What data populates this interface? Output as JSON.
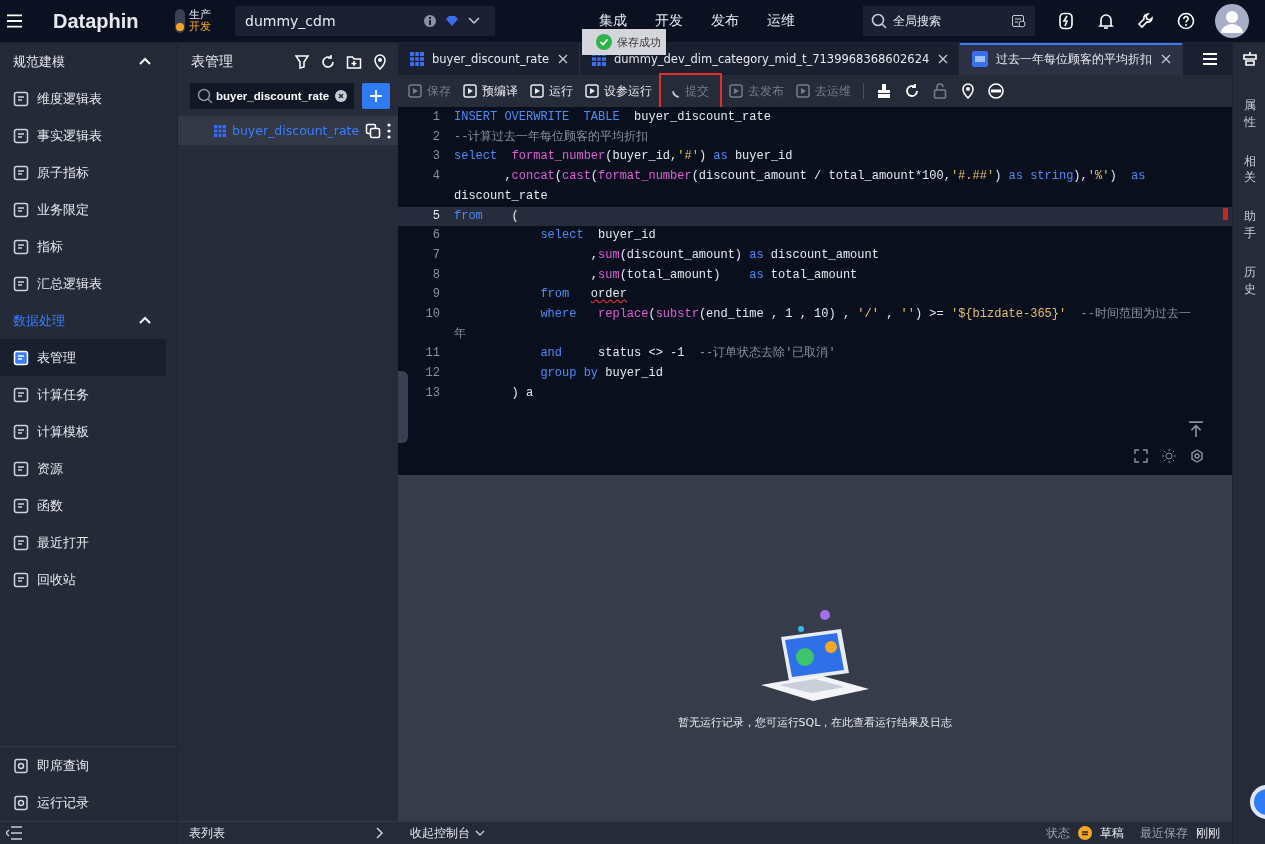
{
  "topbar": {
    "logo": "Dataphin",
    "env": [
      {
        "label": "生产",
        "selected": false
      },
      {
        "label": "开发",
        "selected": true
      }
    ],
    "project": "dummy_cdm",
    "nav": [
      {
        "label": "集成",
        "selected": false
      },
      {
        "label": "开发",
        "selected": false
      },
      {
        "label": "发布",
        "selected": false
      },
      {
        "label": "运维",
        "selected": false
      }
    ],
    "search": {
      "placeholder": "全局搜索"
    }
  },
  "toast": {
    "text": "保存成功"
  },
  "sidebar": {
    "groups": [
      {
        "title": "规范建模",
        "expanded": true,
        "items": [
          {
            "label": "维度逻辑表",
            "selected": false
          },
          {
            "label": "事实逻辑表",
            "selected": false
          },
          {
            "label": "原子指标",
            "selected": false
          },
          {
            "label": "业务限定",
            "selected": false
          },
          {
            "label": "指标",
            "selected": false
          },
          {
            "label": "汇总逻辑表",
            "selected": false
          }
        ]
      },
      {
        "title": "数据处理",
        "expanded": true,
        "items": [
          {
            "label": "表管理",
            "selected": true
          },
          {
            "label": "计算任务",
            "selected": false
          },
          {
            "label": "计算模板",
            "selected": false
          },
          {
            "label": "资源",
            "selected": false
          },
          {
            "label": "函数",
            "selected": false
          },
          {
            "label": "最近打开",
            "selected": false
          },
          {
            "label": "回收站",
            "selected": false
          }
        ]
      }
    ],
    "bottom_items": [
      {
        "label": "即席查询"
      },
      {
        "label": "运行记录"
      }
    ]
  },
  "panel": {
    "title": "表管理",
    "search": {
      "value": "buyer_discount_rate"
    },
    "tree": [
      {
        "label": "buyer_discount_rate",
        "selected": true
      }
    ],
    "footer": "表列表"
  },
  "tabs": [
    {
      "label": "buyer_discount_rate",
      "selected": false
    },
    {
      "label": "dummy_dev_dim_category_mid_t_7139968368602624",
      "selected": false
    },
    {
      "label": "过去一年每位顾客的平均折扣",
      "selected": true
    }
  ],
  "toolbar": [
    {
      "label": "保存",
      "disabled": true,
      "loading": false,
      "highlighted": false
    },
    {
      "label": "预编译",
      "disabled": false,
      "loading": false,
      "highlighted": false
    },
    {
      "label": "运行",
      "disabled": false,
      "loading": false,
      "highlighted": false
    },
    {
      "label": "设参运行",
      "disabled": false,
      "loading": false,
      "highlighted": false
    },
    {
      "label": "提交",
      "disabled": true,
      "loading": true,
      "highlighted": true
    },
    {
      "label": "去发布",
      "disabled": true,
      "loading": false,
      "highlighted": false
    },
    {
      "label": "去运维",
      "disabled": true,
      "loading": false,
      "highlighted": false
    }
  ],
  "code": {
    "lines": [
      {
        "number": "1",
        "rows": [
          [
            {
              "kind": "kw",
              "text": "INSERT OVERWRITE  TABLE"
            },
            {
              "kind": "id",
              "text": "  buyer_discount_rate"
            }
          ]
        ]
      },
      {
        "number": "2",
        "rows": [
          [
            {
              "kind": "cm",
              "text": "--计算过去一年每位顾客的平均折扣"
            }
          ]
        ]
      },
      {
        "number": "3",
        "rows": [
          [
            {
              "kind": "kw",
              "text": "select"
            },
            {
              "kind": "id",
              "text": "  "
            },
            {
              "kind": "fn",
              "text": "format_number"
            },
            {
              "kind": "id",
              "text": "(buyer_id,"
            },
            {
              "kind": "str",
              "text": "'#'"
            },
            {
              "kind": "id",
              "text": ") "
            },
            {
              "kind": "kw",
              "text": "as"
            },
            {
              "kind": "id",
              "text": " buyer_id"
            }
          ]
        ]
      },
      {
        "number": "4",
        "rows": [
          [
            {
              "kind": "id",
              "text": "       ,"
            },
            {
              "kind": "fn",
              "text": "concat"
            },
            {
              "kind": "id",
              "text": "("
            },
            {
              "kind": "fn",
              "text": "cast"
            },
            {
              "kind": "id",
              "text": "("
            },
            {
              "kind": "fn",
              "text": "format_number"
            },
            {
              "kind": "id",
              "text": "(discount_amount / total_amount*100,"
            },
            {
              "kind": "str",
              "text": "'#.##'"
            },
            {
              "kind": "id",
              "text": ") "
            },
            {
              "kind": "kw",
              "text": "as string"
            },
            {
              "kind": "id",
              "text": "),"
            },
            {
              "kind": "str",
              "text": "'%'"
            },
            {
              "kind": "id",
              "text": ")  "
            },
            {
              "kind": "kw",
              "text": "as"
            }
          ],
          [
            {
              "kind": "id",
              "text": "discount_rate"
            }
          ]
        ]
      },
      {
        "number": "5",
        "current": true,
        "rows": [
          [
            {
              "kind": "kw",
              "text": "from"
            },
            {
              "kind": "id",
              "text": "    ("
            }
          ]
        ]
      },
      {
        "number": "6",
        "rows": [
          [
            {
              "kind": "id",
              "text": "            "
            },
            {
              "kind": "kw",
              "text": "select"
            },
            {
              "kind": "id",
              "text": "  buyer_id"
            }
          ]
        ]
      },
      {
        "number": "7",
        "rows": [
          [
            {
              "kind": "id",
              "text": "                   ,"
            },
            {
              "kind": "fn",
              "text": "sum"
            },
            {
              "kind": "id",
              "text": "(discount_amount) "
            },
            {
              "kind": "kw",
              "text": "as"
            },
            {
              "kind": "id",
              "text": " discount_amount"
            }
          ]
        ]
      },
      {
        "number": "8",
        "rows": [
          [
            {
              "kind": "id",
              "text": "                   ,"
            },
            {
              "kind": "fn",
              "text": "sum"
            },
            {
              "kind": "id",
              "text": "(total_amount)    "
            },
            {
              "kind": "kw",
              "text": "as"
            },
            {
              "kind": "id",
              "text": " total_amount"
            }
          ]
        ]
      },
      {
        "number": "9",
        "rows": [
          [
            {
              "kind": "id",
              "text": "            "
            },
            {
              "kind": "kw",
              "text": "from"
            },
            {
              "kind": "id",
              "text": "   "
            },
            {
              "kind": "err",
              "text": "order"
            }
          ]
        ]
      },
      {
        "number": "10",
        "rows": [
          [
            {
              "kind": "id",
              "text": "            "
            },
            {
              "kind": "kw",
              "text": "where"
            },
            {
              "kind": "id",
              "text": "   "
            },
            {
              "kind": "fn",
              "text": "replace"
            },
            {
              "kind": "id",
              "text": "("
            },
            {
              "kind": "fn",
              "text": "substr"
            },
            {
              "kind": "id",
              "text": "(end_time , 1 , 10) , "
            },
            {
              "kind": "str",
              "text": "'/'"
            },
            {
              "kind": "id",
              "text": " , "
            },
            {
              "kind": "str",
              "text": "''"
            },
            {
              "kind": "id",
              "text": ") >= "
            },
            {
              "kind": "str",
              "text": "'${bizdate-365}'"
            },
            {
              "kind": "cm",
              "text": "  --时间范围为过去一"
            }
          ],
          [
            {
              "kind": "cm",
              "text": "年"
            }
          ]
        ]
      },
      {
        "number": "11",
        "rows": [
          [
            {
              "kind": "id",
              "text": "            "
            },
            {
              "kind": "kw",
              "text": "and"
            },
            {
              "kind": "id",
              "text": "     status <> -1  "
            },
            {
              "kind": "cm",
              "text": "--订单状态去除'已取消'"
            }
          ]
        ]
      },
      {
        "number": "12",
        "rows": [
          [
            {
              "kind": "id",
              "text": "            "
            },
            {
              "kind": "kw",
              "text": "group by"
            },
            {
              "kind": "id",
              "text": " buyer_id"
            }
          ]
        ]
      },
      {
        "number": "13",
        "rows": [
          [
            {
              "kind": "id",
              "text": "        ) a"
            }
          ]
        ]
      }
    ]
  },
  "rail": [
    "属性",
    "相关",
    "助手",
    "历史"
  ],
  "console": {
    "empty_text": "暂无运行记录，您可运行SQL，在此查看运行结果及日志",
    "toggle": "收起控制台"
  },
  "status_bar": {
    "status_label": "状态",
    "status": "草稿",
    "saved_label": "最近保存",
    "saved": "刚刚"
  }
}
